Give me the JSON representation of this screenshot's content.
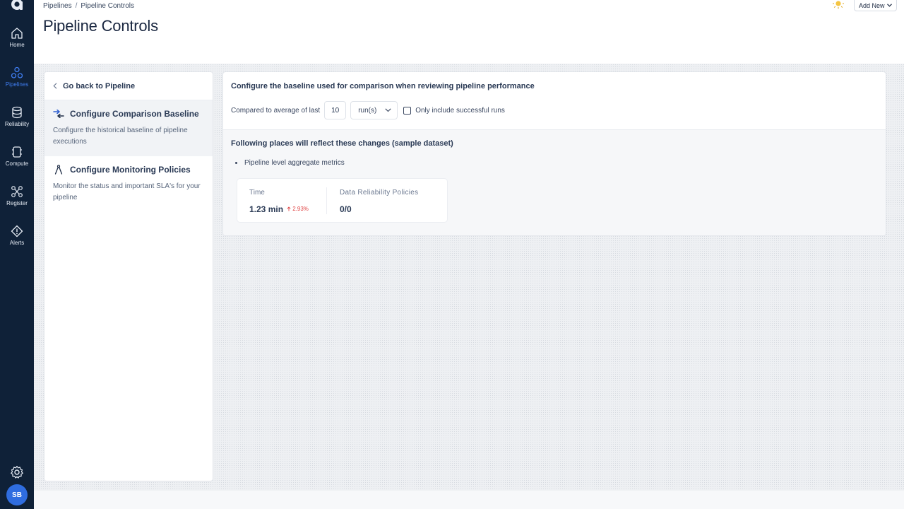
{
  "sidebar": {
    "items": [
      {
        "label": "Home",
        "icon": "home-icon"
      },
      {
        "label": "Pipelines",
        "icon": "pipelines-icon",
        "active": true
      },
      {
        "label": "Reliability",
        "icon": "database-icon"
      },
      {
        "label": "Compute",
        "icon": "chip-icon"
      },
      {
        "label": "Register",
        "icon": "register-icon"
      },
      {
        "label": "Alerts",
        "icon": "alert-icon"
      }
    ],
    "avatar_initials": "SB",
    "accent_color": "#3f7df0"
  },
  "header": {
    "breadcrumb": [
      "Pipelines",
      "Pipeline Controls"
    ],
    "breadcrumb_separator": "/",
    "title": "Pipeline Controls",
    "add_new_label": "Add New"
  },
  "left_panel": {
    "back_label": "Go back to Pipeline",
    "menu": [
      {
        "title": "Configure Comparison Baseline",
        "description": "Configure the historical baseline of pipeline executions",
        "active": true
      },
      {
        "title": "Configure Monitoring Policies",
        "description": "Monitor the status and important SLA's for your pipeline",
        "active": false
      }
    ]
  },
  "config": {
    "heading": "Configure the baseline used for comparison when reviewing pipeline performance",
    "compare_label": "Compared to average of last",
    "run_count": "10",
    "unit": "run(s)",
    "successful_only_label": "Only include successful runs",
    "successful_only_checked": false
  },
  "changes": {
    "heading": "Following places will reflect these changes (sample dataset)",
    "bullet": "Pipeline level aggregate metrics",
    "metrics": {
      "time_label": "Time",
      "time_value": "1.23 min",
      "time_delta": "2.93%",
      "reliability_label": "Data Reliability Policies",
      "reliability_value": "0/0"
    }
  }
}
